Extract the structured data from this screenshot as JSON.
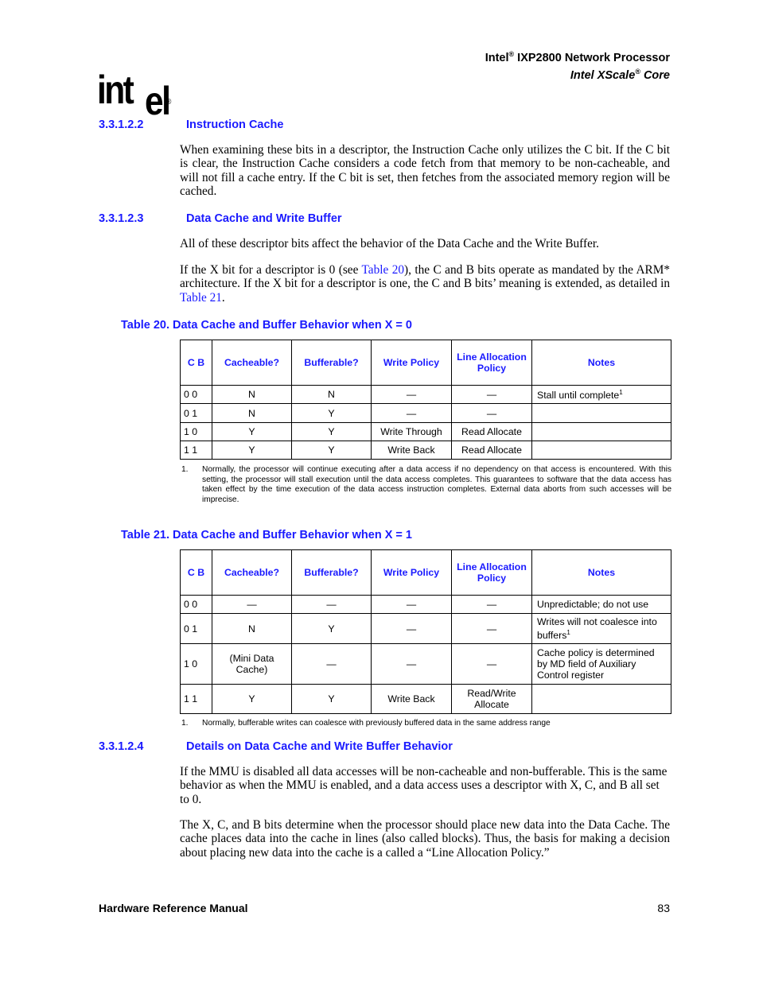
{
  "header": {
    "line1_prefix": "Intel",
    "line1_reg": "®",
    "line1_suffix": " IXP2800 Network Processor",
    "line2_prefix": "Intel XScale",
    "line2_reg": "®",
    "line2_suffix": " Core"
  },
  "logo": {
    "text_int": "int",
    "text_el": "el",
    "reg": "®"
  },
  "sections": [
    {
      "number": "3.3.1.2.2",
      "title": "Instruction Cache",
      "paragraphs": [
        "When examining these bits in a descriptor, the Instruction Cache only utilizes the C bit. If the C bit is clear, the Instruction Cache considers a code fetch from that memory to be non-cacheable, and will not fill a cache entry. If the C bit is set, then fetches from the associated memory region will be cached."
      ]
    },
    {
      "number": "3.3.1.2.3",
      "title": "Data Cache and Write Buffer",
      "paragraphs": [
        "All of these descriptor bits affect the behavior of the Data Cache and the Write Buffer."
      ],
      "para2": {
        "part1": "If the X bit for a descriptor is 0 (see ",
        "link1": "Table 20",
        "part2": "), the C and B bits operate as mandated by the ARM* architecture. If the X bit for a descriptor is one, the C and B bits’ meaning is extended, as detailed in ",
        "link2": "Table 21",
        "part3": "."
      }
    },
    {
      "number": "3.3.1.2.4",
      "title": "Details on Data Cache and Write Buffer Behavior",
      "paragraphs": [
        "If the MMU is disabled all data accesses will be non-cacheable and non-bufferable. This is the same behavior as when the MMU is enabled, and a data access uses a descriptor with X, C, and B all set to 0.",
        "The X, C, and B bits determine when the processor should place new data into the Data Cache. The cache places data into the cache in lines (also called blocks). Thus, the basis for making a decision about placing new data into the cache is a called a “Line Allocation Policy.”"
      ]
    }
  ],
  "tables": [
    {
      "caption": "Table 20.  Data Cache and Buffer Behavior when X = 0",
      "headers": [
        "C B",
        "Cacheable?",
        "Bufferable?",
        "Write Policy",
        "Line Allocation Policy",
        "Notes"
      ],
      "rows": [
        [
          "0 0",
          "N",
          "N",
          "—",
          "—",
          "Stall until complete",
          "1"
        ],
        [
          "0 1",
          "N",
          "Y",
          "—",
          "—",
          "",
          ""
        ],
        [
          "1 0",
          "Y",
          "Y",
          "Write Through",
          "Read Allocate",
          "",
          ""
        ],
        [
          "1 1",
          "Y",
          "Y",
          "Write Back",
          "Read Allocate",
          "",
          ""
        ]
      ],
      "footnote_num": "1.",
      "footnote": "Normally, the processor will continue executing after a data access if no dependency on that access is encountered. With this setting, the processor will stall execution until the data access completes. This guarantees to software that the data access has taken effect by the time execution of the data access instruction completes. External data aborts from such accesses will be imprecise."
    },
    {
      "caption": "Table 21.  Data Cache and Buffer Behavior when X = 1",
      "headers": [
        "C B",
        "Cacheable?",
        "Bufferable?",
        "Write Policy",
        "Line Allocation Policy",
        "Notes"
      ],
      "rows": [
        [
          "0 0",
          "—",
          "—",
          "—",
          "—",
          "Unpredictable; do not use",
          ""
        ],
        [
          "0 1",
          "N",
          "Y",
          "—",
          "—",
          "Writes will not coalesce into buffers",
          "1"
        ],
        [
          "1 0",
          "(Mini Data Cache)",
          "—",
          "—",
          "—",
          "Cache policy is determined by MD field of Auxiliary Control register",
          ""
        ],
        [
          "1 1",
          "Y",
          "Y",
          "Write Back",
          "Read/Write Allocate",
          "",
          ""
        ]
      ],
      "footnote_num": "1.",
      "footnote": "Normally, bufferable writes can coalesce with previously buffered data in the same address range"
    }
  ],
  "footer": {
    "title": "Hardware Reference Manual",
    "page": "83"
  }
}
